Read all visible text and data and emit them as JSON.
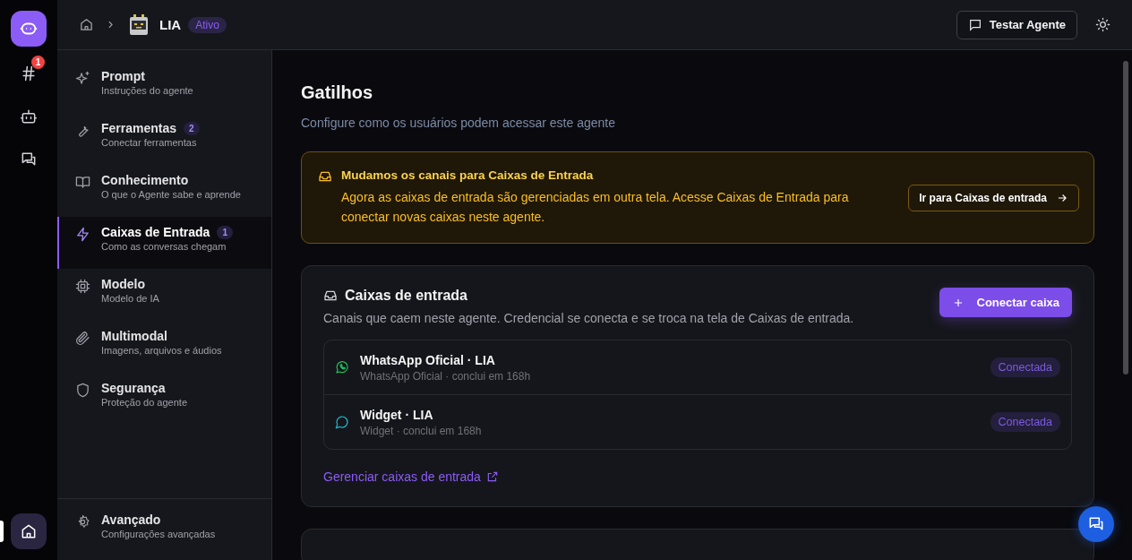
{
  "rail": {
    "items": [
      {
        "kind": "hash",
        "badge": "1",
        "selected": false
      },
      {
        "kind": "bot",
        "selected": false
      },
      {
        "kind": "chats",
        "selected": false
      }
    ],
    "bottom": {
      "kind": "home",
      "selected": true
    }
  },
  "breadcrumb": {
    "agent": "LIA",
    "status": "Ativo"
  },
  "header": {
    "test_button": "Testar Agente"
  },
  "nav": {
    "items": [
      {
        "kind": "sparkles",
        "title": "Prompt",
        "subtitle": "Instruções do agente",
        "selected": false
      },
      {
        "kind": "wrench",
        "title": "Ferramentas",
        "count": "2",
        "subtitle": "Conectar ferramentas",
        "selected": false
      },
      {
        "kind": "book",
        "title": "Conhecimento",
        "subtitle": "O que o Agente sabe e aprende",
        "selected": false
      },
      {
        "kind": "bolt",
        "title": "Caixas de Entrada",
        "count": "1",
        "subtitle": "Como as conversas chegam",
        "selected": true
      },
      {
        "kind": "chip",
        "title": "Modelo",
        "subtitle": "Modelo de IA",
        "selected": false
      },
      {
        "kind": "clip",
        "title": "Multimodal",
        "subtitle": "Imagens, arquivos e áudios",
        "selected": false
      },
      {
        "kind": "shield",
        "title": "Segurança",
        "subtitle": "Proteção do agente",
        "selected": false
      }
    ],
    "footer": {
      "kind": "gear",
      "title": "Avançado",
      "subtitle": "Configurações avançadas",
      "selected": false
    }
  },
  "page": {
    "title": "Gatilhos",
    "subtitle": "Configure como os usuários podem acessar este agente"
  },
  "notice": {
    "title": "Mudamos os canais para Caixas de Entrada",
    "text": "Agora as caixas de entrada são gerenciadas em outra tela. Acesse Caixas de Entrada para conectar novas caixas neste agente.",
    "button": "Ir para Caixas de entrada"
  },
  "inboxes": {
    "title": "Caixas de entrada",
    "description": "Canais que caem neste agente. Credencial se conecta e se troca na tela de Caixas de entrada.",
    "button": "Conectar caixa",
    "items": [
      {
        "kind": "whatsapp",
        "name": "WhatsApp Oficial · LIA",
        "detail": "WhatsApp Oficial · conclui em 168h",
        "status": "Conectada"
      },
      {
        "kind": "widget",
        "name": "Widget · LIA",
        "detail": "Widget · conclui em 168h",
        "status": "Conectada"
      }
    ],
    "link": "Gerenciar caixas de entrada"
  }
}
